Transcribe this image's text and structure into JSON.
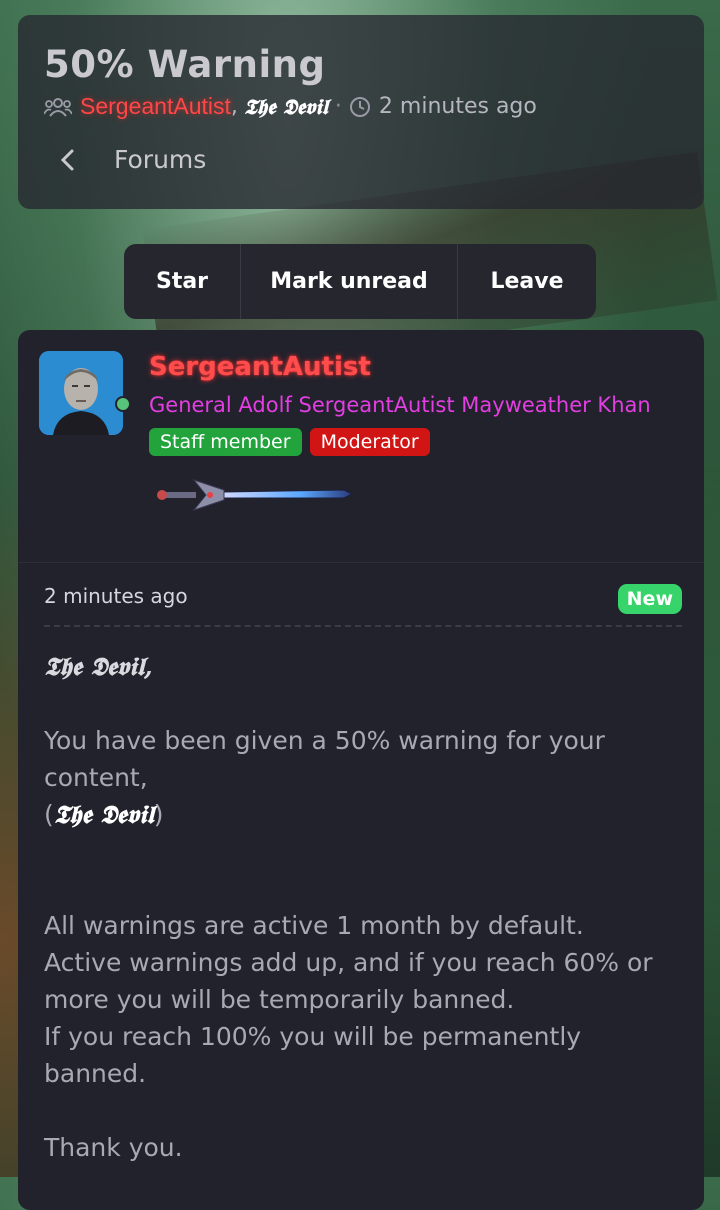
{
  "thread": {
    "title": "50% Warning",
    "participant_1": "SergeantAutist",
    "participant_comma": ",",
    "participant_2": "𝕿𝖍𝖊 𝕯𝖊𝖛𝖎𝖑",
    "separator": "·",
    "time": "2 minutes ago",
    "back_label": "Forums"
  },
  "actions": {
    "star": "Star",
    "mark_unread": "Mark unread",
    "leave": "Leave"
  },
  "post": {
    "username": "SergeantAutist",
    "user_title": "General Adolf SergeantAutist Mayweather Khan",
    "badges": [
      "Staff member",
      "Moderator"
    ],
    "time": "2 minutes ago",
    "new_label": "New",
    "greeting": "𝕿𝖍𝖊 𝕯𝖊𝖛𝖎𝖑,",
    "line1": "You have been given a 50% warning for your content,",
    "line2_open": "(",
    "line2_name": "𝕿𝖍𝖊 𝕯𝖊𝖛𝖎𝖑",
    "line2_close": ")",
    "para2_line1": "All warnings are active 1 month by default.",
    "para2_line2": "Active warnings add up, and if you reach 60% or more you will be temporarily banned.",
    "para2_line3": "If you reach 100% you will be permanently banned.",
    "closing": "Thank you."
  },
  "icons": {
    "participants": "users-icon",
    "time": "clock-icon",
    "back": "chevron-left-icon",
    "online": "online-status-icon",
    "rank": "sword-icon"
  },
  "colors": {
    "username_red": "#ff4d4d",
    "user_title_magenta": "#e23ee2",
    "staff_green": "#23a33c",
    "moderator_red": "#d11414",
    "new_green": "#36d46a",
    "online_green": "#58c27a"
  }
}
